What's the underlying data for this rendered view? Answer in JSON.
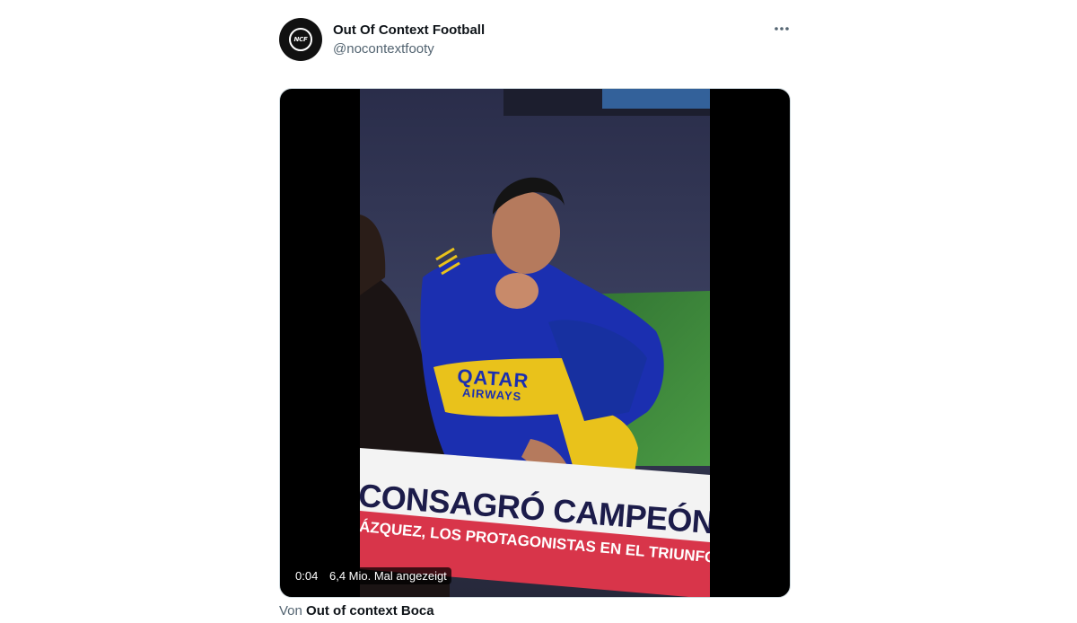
{
  "tweet": {
    "author_name": "Out Of Context Football",
    "author_handle": "@nocontextfooty",
    "avatar_text": "NCF",
    "more_icon": "more-dots-icon"
  },
  "video": {
    "elapsed": "0:04",
    "views": "6,4 Mio. Mal angezeigt",
    "banner_main": "CONSAGRÓ CAMPEÓN DE LA CO",
    "banner_sub": "ÁZQUEZ, LOS PROTAGONISTAS EN EL TRIUNFO AN",
    "shirt_sponsor_line1": "QATAR",
    "shirt_sponsor_line2": "AIRWAYS"
  },
  "caption": {
    "prefix": "Von",
    "source": "Out of context Boca"
  },
  "colors": {
    "name": "#0f1419",
    "secondary": "#536471",
    "shirt_blue": "#1b2fb0",
    "shirt_yellow": "#e9c21b",
    "pitch_green": "#3c8a3a"
  }
}
